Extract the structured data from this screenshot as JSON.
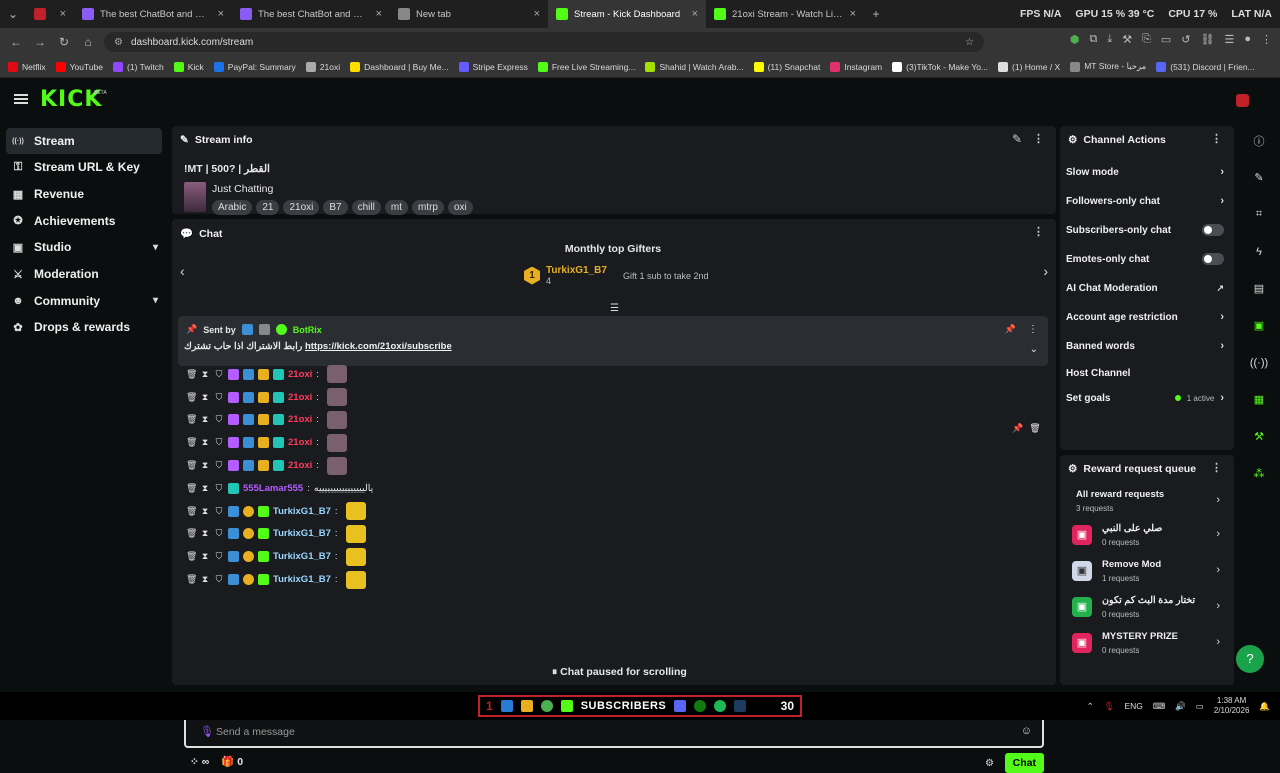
{
  "browser": {
    "tabs": [
      {
        "title": "",
        "color": "#c0212b",
        "active": false
      },
      {
        "title": "The best ChatBot and Widg",
        "color": "#8a5cf6",
        "active": false
      },
      {
        "title": "The best ChatBot and Widgets",
        "color": "#8a5cf6",
        "active": false
      },
      {
        "title": "New tab",
        "color": "#888888",
        "active": false
      },
      {
        "title": "Stream - Kick Dashboard",
        "color": "#53fc18",
        "active": true
      },
      {
        "title": "21oxi Stream - Watch Live on K",
        "color": "#53fc18",
        "active": false
      }
    ],
    "stats": {
      "fps": "FPS  N/A",
      "gpu": "GPU  15 %  39 °C",
      "cpu": "CPU  17 %",
      "lat": "LAT  N/A"
    },
    "url": "dashboard.kick.com/stream",
    "bookmarks": [
      {
        "label": "Netflix",
        "color": "#e50914"
      },
      {
        "label": "YouTube",
        "color": "#ff0000"
      },
      {
        "label": "(1) Twitch",
        "color": "#9146ff"
      },
      {
        "label": "Kick",
        "color": "#53fc18"
      },
      {
        "label": "PayPal: Summary",
        "color": "#1a73e8"
      },
      {
        "label": "21oxi",
        "color": "#aaaaaa"
      },
      {
        "label": "Dashboard | Buy Me...",
        "color": "#ffdd00"
      },
      {
        "label": "Stripe Express",
        "color": "#635bff"
      },
      {
        "label": "Free Live Streaming...",
        "color": "#53fc18"
      },
      {
        "label": "Shahid | Watch Arab...",
        "color": "#a4e000"
      },
      {
        "label": "(11) Snapchat",
        "color": "#fffc00"
      },
      {
        "label": "Instagram",
        "color": "#e1306c"
      },
      {
        "label": "(3)TikTok - Make Yo...",
        "color": "#ffffff"
      },
      {
        "label": "(1) Home / X",
        "color": "#dddddd"
      },
      {
        "label": "MT Store - مرحبا",
        "color": "#888888"
      },
      {
        "label": "(531) Discord | Frien...",
        "color": "#5865f2"
      }
    ]
  },
  "app": {
    "brand": "KICK",
    "beta": "BETA"
  },
  "sidebar": {
    "items": [
      {
        "label": "Stream",
        "icon": "stream-icon",
        "glyph": "((·))",
        "chev": false
      },
      {
        "label": "Stream URL & Key",
        "icon": "key-icon",
        "glyph": "⚿",
        "chev": false
      },
      {
        "label": "Revenue",
        "icon": "revenue-icon",
        "glyph": "▦",
        "chev": false
      },
      {
        "label": "Achievements",
        "icon": "trophy-icon",
        "glyph": "✪",
        "chev": false
      },
      {
        "label": "Studio",
        "icon": "studio-icon",
        "glyph": "▣",
        "chev": true
      },
      {
        "label": "Moderation",
        "icon": "sword-icon",
        "glyph": "⚔",
        "chev": false
      },
      {
        "label": "Community",
        "icon": "community-icon",
        "glyph": "☻",
        "chev": true
      },
      {
        "label": "Drops & rewards",
        "icon": "gift-icon",
        "glyph": "✿",
        "chev": false
      }
    ]
  },
  "stream_info": {
    "header": "Stream info",
    "title": "!MT | 500? | القطر",
    "category": "Just Chatting",
    "tags": [
      "Arabic",
      "21",
      "21oxi",
      "B7",
      "chill",
      "mt",
      "mtrp",
      "oxi"
    ]
  },
  "chat": {
    "header": "Chat",
    "gifters_title": "Monthly top Gifters",
    "top_gifter": {
      "rank": "1",
      "name": "TurkixG1_B7",
      "count": "4"
    },
    "gifter_hint": "Gift 1 sub to take 2nd",
    "pinned": {
      "sent_by": "Sent by",
      "user": "BotRix",
      "text": "رابط الاشتراك اذا حاب تشترك",
      "link": "https://kick.com/21oxi/subscribe"
    },
    "messages": [
      {
        "user": "21oxi",
        "color": "#ff3b5c",
        "text": ""
      },
      {
        "user": "21oxi",
        "color": "#ff3b5c",
        "text": ""
      },
      {
        "user": "21oxi",
        "color": "#ff3b5c",
        "text": ""
      },
      {
        "user": "21oxi",
        "color": "#ff3b5c",
        "text": ""
      },
      {
        "user": "21oxi",
        "color": "#ff3b5c",
        "text": ""
      },
      {
        "user": "555Lamar555",
        "color": "#b45cff",
        "text": "يالييييييييييييييييه"
      },
      {
        "user": "TurkixG1_B7",
        "color": "#9ad7ff",
        "text": ""
      },
      {
        "user": "TurkixG1_B7",
        "color": "#9ad7ff",
        "text": ""
      },
      {
        "user": "TurkixG1_B7",
        "color": "#9ad7ff",
        "text": ""
      },
      {
        "user": "TurkixG1_B7",
        "color": "#9ad7ff",
        "text": ""
      }
    ],
    "paused": "Chat paused for scrolling",
    "input_placeholder": "Send a message",
    "footer_infinity": "∞",
    "footer_gifts": "0",
    "send_label": "Chat"
  },
  "channel_actions": {
    "header": "Channel Actions",
    "items": [
      {
        "label": "Slow mode",
        "kind": "arrow"
      },
      {
        "label": "Followers-only chat",
        "kind": "arrow"
      },
      {
        "label": "Subscribers-only chat",
        "kind": "toggle"
      },
      {
        "label": "Emotes-only chat",
        "kind": "toggle"
      },
      {
        "label": "AI Chat Moderation",
        "kind": "external"
      },
      {
        "label": "Account age restriction",
        "kind": "arrow"
      },
      {
        "label": "Banned words",
        "kind": "arrow"
      },
      {
        "label": "Host Channel",
        "kind": "none"
      },
      {
        "label": "Set goals",
        "kind": "goals",
        "extra": "1 active"
      }
    ]
  },
  "reward_queue": {
    "header": "Reward request queue",
    "all_label": "All reward requests",
    "all_count": "3 requests",
    "items": [
      {
        "name": "صلي على النبي",
        "count": "0 requests",
        "color": "#e0245e"
      },
      {
        "name": "Remove Mod",
        "count": "1 requests",
        "color": "#d0d8e8"
      },
      {
        "name": "تختار مدة البث كم تكون",
        "count": "0 requests",
        "color": "#22b14c"
      },
      {
        "name": "MYSTERY PRIZE",
        "count": "0 requests",
        "color": "#e0245e"
      }
    ]
  },
  "taskbar": {
    "left_num": "1",
    "label": "SUBSCRIBERS",
    "right_num": "30",
    "lang": "ENG",
    "time": "1:38 AM",
    "date": "2/10/2026"
  }
}
